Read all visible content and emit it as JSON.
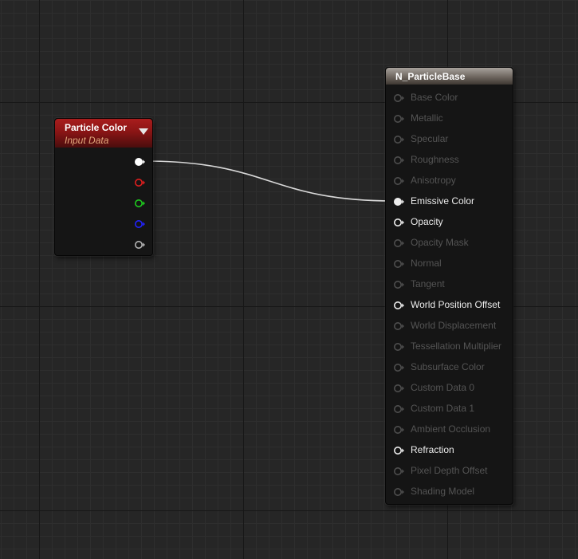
{
  "particle_color_node": {
    "title": "Particle Color",
    "subtitle": "Input Data",
    "outputs": [
      {
        "name": "rgb",
        "color": "#ffffff",
        "connected": true
      },
      {
        "name": "r",
        "color": "#e01e1e",
        "connected": false
      },
      {
        "name": "g",
        "color": "#1ecc1e",
        "connected": false
      },
      {
        "name": "b",
        "color": "#2323ff",
        "connected": false
      },
      {
        "name": "a",
        "color": "#b4b4b4",
        "connected": false
      }
    ]
  },
  "material_node": {
    "title": "N_ParticleBase",
    "inputs": [
      {
        "label": "Base Color",
        "active": false,
        "connected": false
      },
      {
        "label": "Metallic",
        "active": false,
        "connected": false
      },
      {
        "label": "Specular",
        "active": false,
        "connected": false
      },
      {
        "label": "Roughness",
        "active": false,
        "connected": false
      },
      {
        "label": "Anisotropy",
        "active": false,
        "connected": false
      },
      {
        "label": "Emissive Color",
        "active": true,
        "connected": true
      },
      {
        "label": "Opacity",
        "active": true,
        "connected": false
      },
      {
        "label": "Opacity Mask",
        "active": false,
        "connected": false
      },
      {
        "label": "Normal",
        "active": false,
        "connected": false
      },
      {
        "label": "Tangent",
        "active": false,
        "connected": false
      },
      {
        "label": "World Position Offset",
        "active": true,
        "connected": false
      },
      {
        "label": "World Displacement",
        "active": false,
        "connected": false
      },
      {
        "label": "Tessellation Multiplier",
        "active": false,
        "connected": false
      },
      {
        "label": "Subsurface Color",
        "active": false,
        "connected": false
      },
      {
        "label": "Custom Data 0",
        "active": false,
        "connected": false
      },
      {
        "label": "Custom Data 1",
        "active": false,
        "connected": false
      },
      {
        "label": "Ambient Occlusion",
        "active": false,
        "connected": false
      },
      {
        "label": "Refraction",
        "active": true,
        "connected": false
      },
      {
        "label": "Pixel Depth Offset",
        "active": false,
        "connected": false
      },
      {
        "label": "Shading Model",
        "active": false,
        "connected": false
      }
    ]
  },
  "wire": {
    "from": "particle_color_node.outputs.0",
    "to": "material_node.inputs.5",
    "color": "#d8d8d8"
  }
}
